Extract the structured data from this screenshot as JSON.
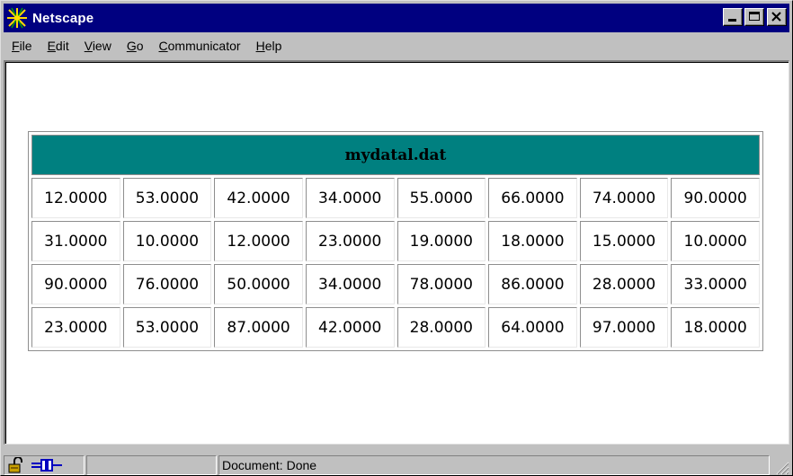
{
  "window": {
    "title": "Netscape"
  },
  "menu": [
    {
      "label": "File",
      "mnemonic": "F",
      "rest": "ile"
    },
    {
      "label": "Edit",
      "mnemonic": "E",
      "rest": "dit"
    },
    {
      "label": "View",
      "mnemonic": "V",
      "rest": "iew"
    },
    {
      "label": "Go",
      "mnemonic": "G",
      "rest": "o"
    },
    {
      "label": "Communicator",
      "mnemonic": "C",
      "rest": "ommunicator"
    },
    {
      "label": "Help",
      "mnemonic": "H",
      "rest": "elp"
    }
  ],
  "table": {
    "title": "mydatal.dat",
    "header_color": "#008080",
    "rows": [
      [
        "12.0000",
        "53.0000",
        "42.0000",
        "34.0000",
        "55.0000",
        "66.0000",
        "74.0000",
        "90.0000"
      ],
      [
        "31.0000",
        "10.0000",
        "12.0000",
        "23.0000",
        "19.0000",
        "18.0000",
        "15.0000",
        "10.0000"
      ],
      [
        "90.0000",
        "76.0000",
        "50.0000",
        "34.0000",
        "78.0000",
        "86.0000",
        "28.0000",
        "33.0000"
      ],
      [
        "23.0000",
        "53.0000",
        "87.0000",
        "42.0000",
        "28.0000",
        "64.0000",
        "97.0000",
        "18.0000"
      ]
    ]
  },
  "status": {
    "text": "Document: Done",
    "icons": [
      "security-lock-icon",
      "connection-plug-icon"
    ]
  },
  "colors": {
    "titlebar": "#000080",
    "chrome": "#c0c0c0"
  }
}
